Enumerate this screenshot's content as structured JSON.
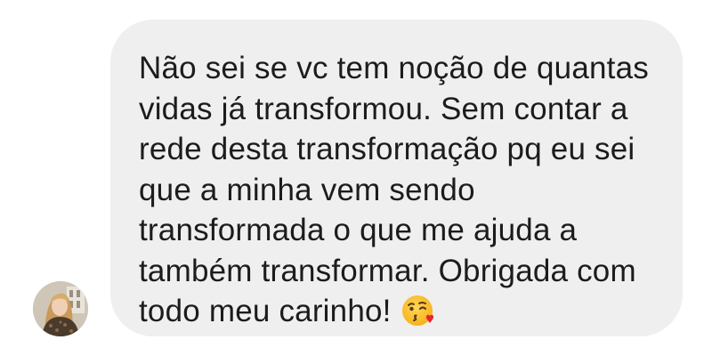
{
  "conversation": {
    "message": {
      "text": "Não sei se vc tem noção de quantas\nvidas já transformou. Sem contar a\nrede desta transformação pq eu sei\nque a minha vem sendo\ntransformada o que me ajuda a\ntambém transformar. Obrigada com\ntodo meu carinho!",
      "emoji": "face-blowing-a-kiss-icon"
    },
    "colors": {
      "bubble_background": "#efefef",
      "text": "#1c1c1c",
      "page_background": "#ffffff"
    }
  }
}
